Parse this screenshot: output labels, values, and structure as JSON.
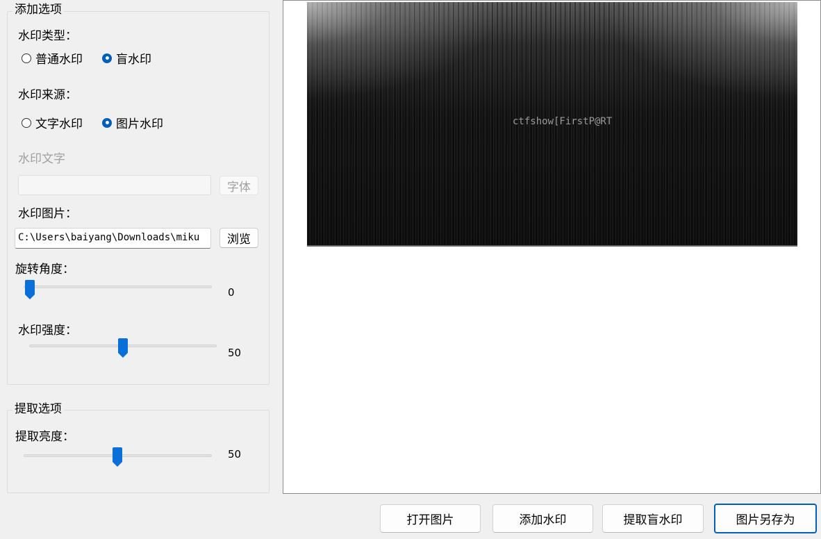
{
  "add_options": {
    "title": "添加选项",
    "watermark_type": {
      "label": "水印类型：",
      "options": [
        "普通水印",
        "盲水印"
      ],
      "selected": "盲水印"
    },
    "watermark_source": {
      "label": "水印来源：",
      "options": [
        "文字水印",
        "图片水印"
      ],
      "selected": "图片水印"
    },
    "watermark_text": {
      "label": "水印文字",
      "value": "",
      "font_button": "字体"
    },
    "watermark_image": {
      "label": "水印图片：",
      "path": "C:\\Users\\baiyang\\Downloads\\miku",
      "browse_button": "浏览"
    },
    "rotation": {
      "label": "旋转角度：",
      "value": "0"
    },
    "strength": {
      "label": "水印强度：",
      "value": "50"
    }
  },
  "extract_options": {
    "title": "提取选项",
    "brightness": {
      "label": "提取亮度：",
      "value": "50"
    }
  },
  "preview": {
    "overlay_text": "ctfshow[FirstP@RT"
  },
  "buttons": {
    "open_image": "打开图片",
    "add_watermark": "添加水印",
    "extract_blind_watermark": "提取盲水印",
    "save_image_as": "图片另存为"
  },
  "colors": {
    "accent": "#005fb8",
    "slider_thumb": "#0a6fd8"
  }
}
